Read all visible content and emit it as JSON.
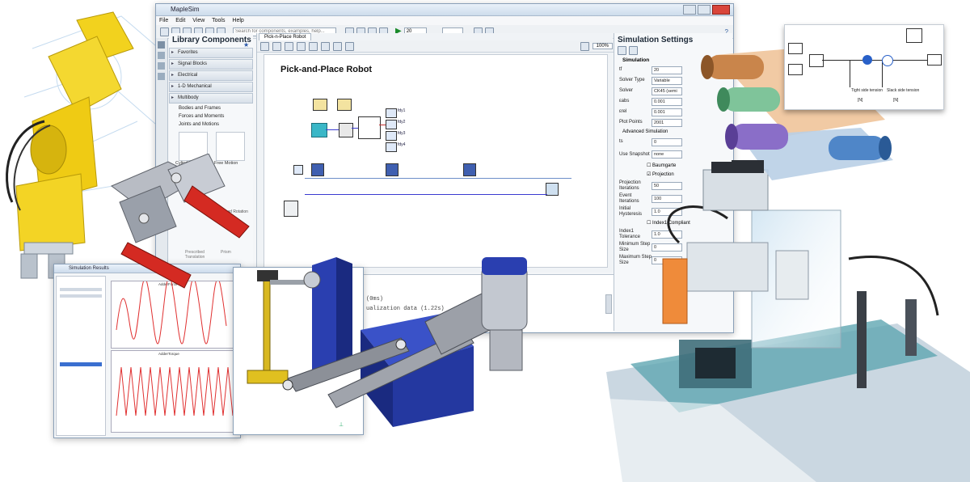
{
  "main_window": {
    "title": "MapleSim",
    "menu": [
      "File",
      "Edit",
      "View",
      "Tools",
      "Help"
    ],
    "search_placeholder": "Search for components, examples, help...",
    "time_value": "20",
    "zoom": "100%"
  },
  "library": {
    "title": "Library Components",
    "items": [
      "Favorites",
      "Signal Blocks",
      "Electrical",
      "1-D Mechanical",
      "Multibody"
    ],
    "sub_items": [
      "Bodies and Frames",
      "Forces and Moments",
      "Joints and Motions"
    ],
    "components": [
      "Cylindrical",
      "Free Motion",
      "Prescribed Rotation",
      "Prescribed Translation",
      "Prism"
    ]
  },
  "diagram": {
    "tab": "Pick-n-Place Robot",
    "title": "Pick-and-Place Robot",
    "labels": [
      "fdy1",
      "fdy2",
      "fdy3",
      "fdy4"
    ]
  },
  "console": {
    "lines": [
      "(0ms)",
      "ualization data (1.22s)"
    ]
  },
  "simulation_settings": {
    "title": "Simulation Settings",
    "section_simulation": "Simulation",
    "rows": [
      {
        "label": "tf",
        "value": "20"
      },
      {
        "label": "Solver Type",
        "value": "Variable"
      },
      {
        "label": "Solver",
        "value": "CK45 (semi"
      },
      {
        "label": "εabs",
        "value": "0.001"
      },
      {
        "label": "εrel",
        "value": "0.001"
      },
      {
        "label": "Plot Points",
        "value": "2001"
      }
    ],
    "section_advanced": "Advanced Simulation",
    "adv_rows": [
      {
        "label": "ts",
        "value": "0"
      },
      {
        "label": "Use Snapshot",
        "value": "none"
      }
    ],
    "checks": [
      "Baumgarte",
      "Projection"
    ],
    "more_rows": [
      {
        "label": "Projection Iterations",
        "value": "50"
      },
      {
        "label": "Event Iterations",
        "value": "100"
      },
      {
        "label": "Initial Hysteresis",
        "value": "1.0"
      },
      {
        "label": "Index1 Tolerance",
        "value": "1.0"
      },
      {
        "label": "Minimum Step Size",
        "value": "0"
      },
      {
        "label": "Maximum Step Size",
        "value": "0"
      }
    ],
    "extra_checks": [
      "Index1 Compliant"
    ]
  },
  "results_window": {
    "title": "Simulation Results",
    "plot_titles": [
      "AdderForce",
      "AdderTorque"
    ]
  },
  "tension_diagram": {
    "labels": [
      "Tight side tension",
      "Slack side tension"
    ],
    "units": [
      "[N]",
      "[N]"
    ]
  },
  "colors": {
    "robot_yellow": "#f2d21e",
    "gripper_red": "#d42a22",
    "mechanism_blue": "#2a3fb0",
    "plot_red": "#e03030",
    "teal_block": "#3ab7c7"
  }
}
